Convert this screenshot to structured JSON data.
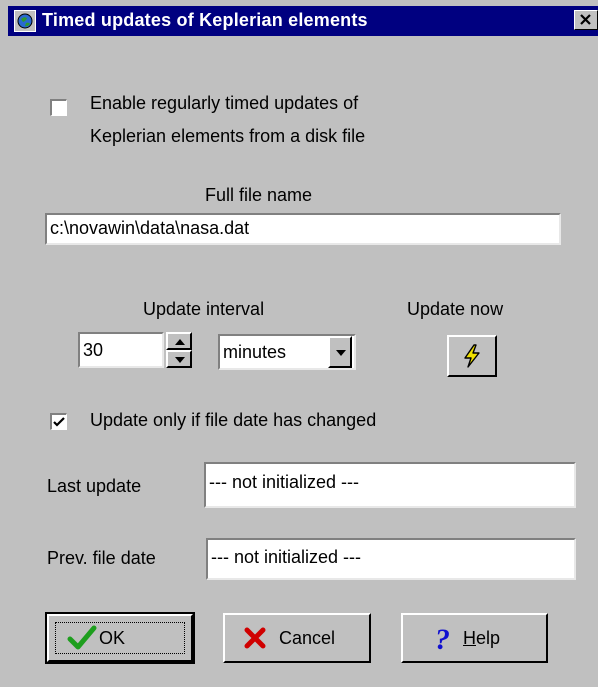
{
  "window": {
    "title": "Timed updates of Keplerian elements"
  },
  "enable_checkbox": {
    "checked": false,
    "label_line1": "Enable regularly timed updates of",
    "label_line2": "Keplerian elements from a disk file"
  },
  "file": {
    "label": "Full file name",
    "value": "c:\\novawin\\data\\nasa.dat"
  },
  "interval": {
    "label": "Update interval",
    "value": "30",
    "unit": "minutes"
  },
  "update_now": {
    "label": "Update now",
    "icon": "lightning-icon"
  },
  "only_if_changed": {
    "checked": true,
    "label": "Update only if file date has changed"
  },
  "last_update": {
    "label": "Last update",
    "value": "--- not initialized ---"
  },
  "prev_file_date": {
    "label": "Prev. file date",
    "value": "--- not initialized ---"
  },
  "buttons": {
    "ok": "OK",
    "cancel": "Cancel",
    "help_mnemonic": "H",
    "help_rest": "elp"
  },
  "colors": {
    "title_bar": "#000080",
    "dialog_bg": "#c0c0c0",
    "ok_check": "#1e9e1e",
    "cancel_x": "#d00000",
    "help_q": "#1010d0",
    "lightning": "#f0e000"
  }
}
